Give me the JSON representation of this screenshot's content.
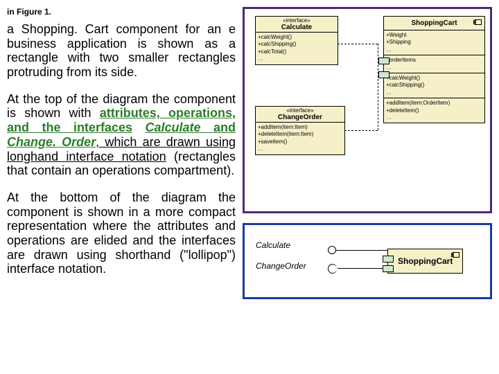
{
  "figref": "in Figure 1.",
  "p1a": "a Shopping. Cart component for an e business application is shown as a rectangle with two smaller rectangles protruding from its side.",
  "p2a": "At the top of the diagram the component is shown with ",
  "p2b": "attributes, operations, and the interfaces",
  "p2c": " ",
  "p2d": "Calculate",
  "p2e": " and ",
  "p2f": "Change. Order",
  "p2g": ", which are drawn using longhand interface notation",
  "p2h": " (rectangles that contain an operations compartment).",
  "p3": "At the bottom of the diagram the component is shown in a more compact representation where the attributes and operations are elided and the interfaces are drawn using shorthand (\"lollipop\") interface notation.",
  "uml": {
    "stereotype": "«interface»",
    "calc": "Calculate",
    "calcOps": [
      "+calcWeight()",
      "+calcShipping()",
      "+calcTotal()"
    ],
    "change": "ChangeOrder",
    "changeOps": [
      "+addItem(item:Item)",
      "+deleteItem(item:Item)",
      "+saveItem()"
    ],
    "comp": "ShoppingCart",
    "attrs": [
      "+Weight",
      "+Shipping"
    ],
    "assoc": "+orderItems",
    "compOps1": [
      "+calcWeight()",
      "+calcShipping()"
    ],
    "compOps2": [
      "+addItem(item:OrderItem)",
      "+deleteItem()"
    ],
    "dots": "…"
  },
  "d2": {
    "calc": "Calculate",
    "change": "ChangeOrder",
    "comp": "ShoppingCart"
  }
}
